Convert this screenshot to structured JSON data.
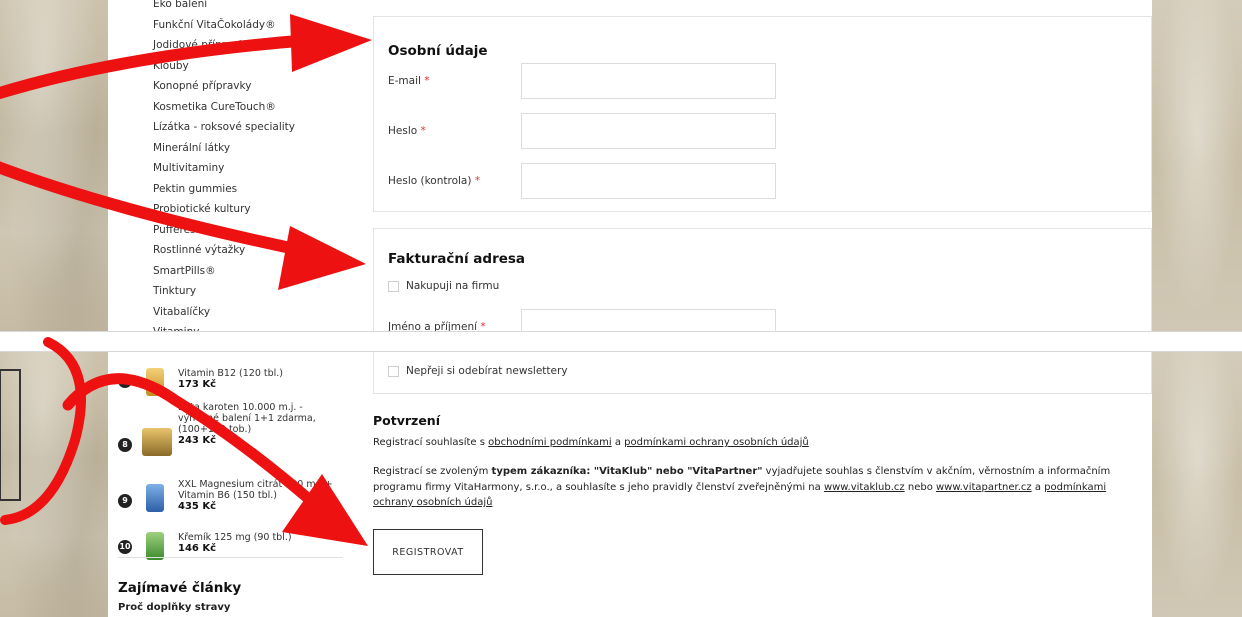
{
  "sidebar": {
    "categories": [
      "Eko balení",
      "Funkční VitaČokolády®",
      "Jodidové přípravky",
      "Klouby",
      "Konopné přípravky",
      "Kosmetika CureTouch®",
      "Lízátka - roksové speciality",
      "Minerální látky",
      "Multivitaminy",
      "Pektin gummies",
      "Probiotické kultury",
      "Pufferest®",
      "Rostlinné výtažky",
      "SmartPills®",
      "Tinktury",
      "Vitabalíčky",
      "Vitaminy"
    ]
  },
  "personal": {
    "title": "Osobní údaje",
    "email_label": "E-mail",
    "password_label": "Heslo",
    "password_confirm_label": "Heslo (kontrola)",
    "required_mark": "*"
  },
  "billing": {
    "title": "Fakturační adresa",
    "company_checkbox_label": "Nakupuji na firmu",
    "name_label": "Jméno a příjmení",
    "required_mark": "*"
  },
  "newsletter": {
    "checkbox_label": "Nepřeji si odebírat newslettery"
  },
  "top_products": [
    {
      "rank": "7",
      "name": "Vitamin B12 (120 tbl.)",
      "price": "173 Kč",
      "color": "#e8b94a"
    },
    {
      "rank": "8",
      "name": "Beta karoten 10.000 m.j. - výhodné balení 1+1 zdarma, (100+100 tob.)",
      "price": "243 Kč",
      "color": "#d9a43a"
    },
    {
      "rank": "9",
      "name": "XXL Magnesium citrát 400 mg + Vitamin B6 (150 tbl.)",
      "price": "435 Kč",
      "color": "#3a78c9"
    },
    {
      "rank": "10",
      "name": "Křemík 125 mg (90 tbl.)",
      "price": "146 Kč",
      "color": "#5fa84a"
    }
  ],
  "articles": {
    "title": "Zajímavé články",
    "first_link": "Proč doplňky stravy"
  },
  "confirmation": {
    "title": "Potvrzení",
    "p1_pre": "Registrací souhlasíte s ",
    "p1_link1": "obchodními podmínkami",
    "p1_mid": " a ",
    "p1_link2": "podmínkami ochrany osobních údajů",
    "p2_pre": "Registrací se zvoleným ",
    "p2_bold1": "typem zákazníka",
    "p2_colon": ": ",
    "p2_bold2": "\"VitaKlub\" nebo \"VitaPartner\"",
    "p2_text": " vyjadřujete souhlas s členstvím v akčním, věrnostním a informačním programu firmy VitaHarmony, s.r.o., a souhlasíte s jeho pravidly členství zveřejněnými na ",
    "p2_link1": "www.vitaklub.cz",
    "p2_or": " nebo ",
    "p2_link2": "www.vitapartner.cz",
    "p2_and": " a ",
    "p2_link3": "podmínkami ochrany osobních údajů"
  },
  "register_button": "REGISTROVAT",
  "colors": {
    "annotation_red": "#ee1111",
    "required_red": "#e0322f",
    "rank_badge": "#222222"
  }
}
